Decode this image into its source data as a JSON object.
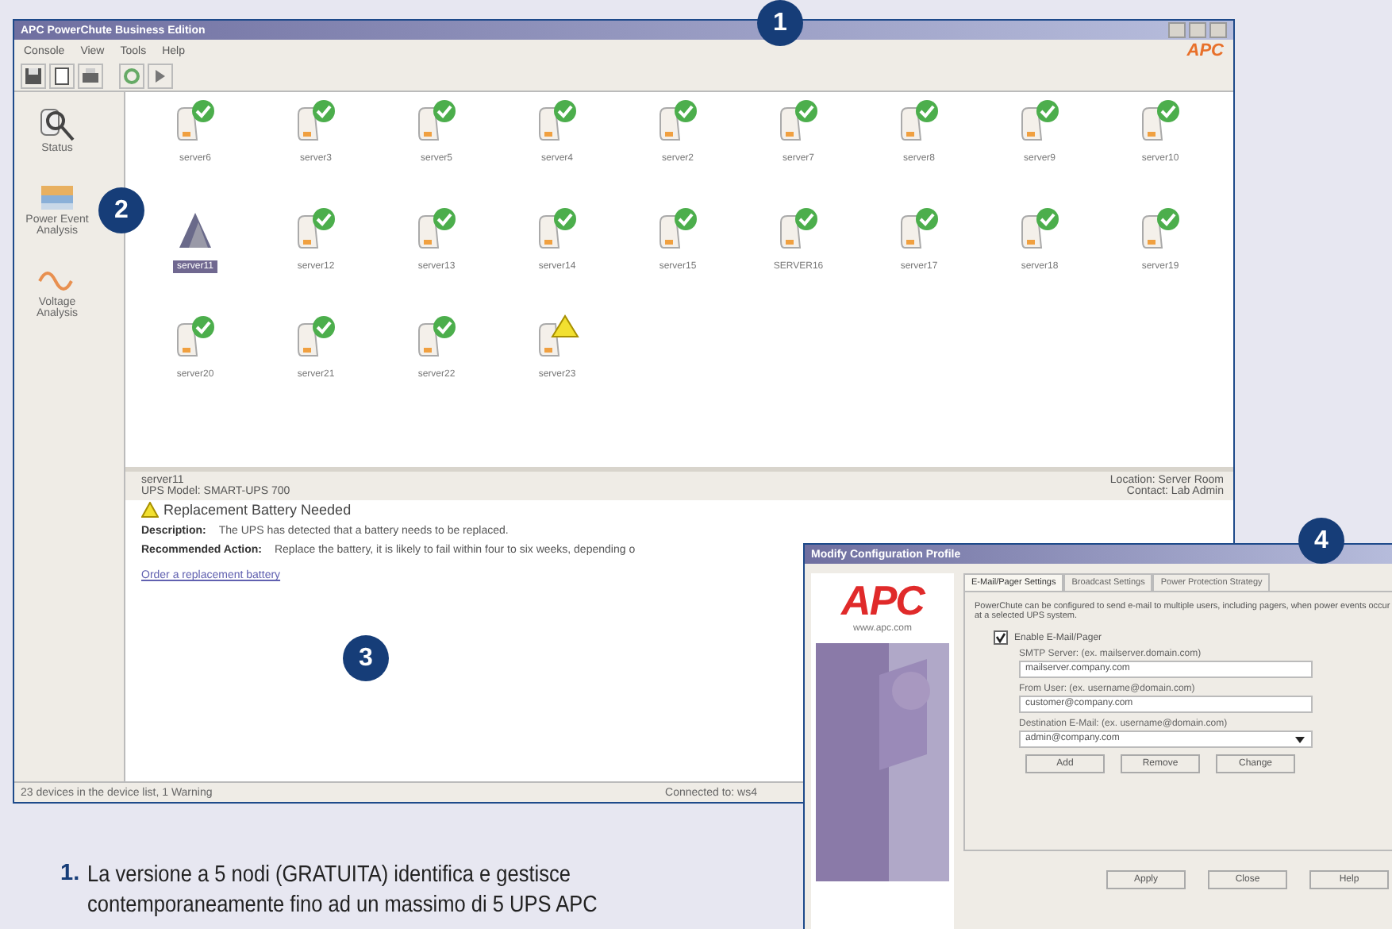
{
  "main_window": {
    "title": "APC PowerChute Business Edition",
    "menu": [
      "Console",
      "View",
      "Tools",
      "Help"
    ],
    "logo": "APC",
    "sidebar": {
      "items": [
        {
          "label": "Status",
          "kind": "status",
          "selected": false
        },
        {
          "label": "Power Event Analysis",
          "kind": "power",
          "selected": false
        },
        {
          "label": "Voltage Analysis",
          "kind": "voltage",
          "selected": false
        }
      ]
    },
    "devices": [
      {
        "name": "server6",
        "kind": "ok",
        "selected": false
      },
      {
        "name": "server3",
        "kind": "ok",
        "selected": false
      },
      {
        "name": "server5",
        "kind": "ok",
        "selected": false
      },
      {
        "name": "server4",
        "kind": "ok",
        "selected": false
      },
      {
        "name": "server2",
        "kind": "ok",
        "selected": false
      },
      {
        "name": "server7",
        "kind": "ok",
        "selected": false
      },
      {
        "name": "server8",
        "kind": "ok",
        "selected": false
      },
      {
        "name": "server9",
        "kind": "ok",
        "selected": false
      },
      {
        "name": "server10",
        "kind": "ok",
        "selected": false
      },
      {
        "name": "server11",
        "kind": "alert",
        "selected": true
      },
      {
        "name": "server12",
        "kind": "ok",
        "selected": false
      },
      {
        "name": "server13",
        "kind": "ok",
        "selected": false
      },
      {
        "name": "server14",
        "kind": "ok",
        "selected": false
      },
      {
        "name": "server15",
        "kind": "ok",
        "selected": false
      },
      {
        "name": "SERVER16",
        "kind": "ok",
        "selected": false
      },
      {
        "name": "server17",
        "kind": "ok",
        "selected": false
      },
      {
        "name": "server18",
        "kind": "ok",
        "selected": false
      },
      {
        "name": "server19",
        "kind": "ok",
        "selected": false
      },
      {
        "name": "server20",
        "kind": "ok",
        "selected": false
      },
      {
        "name": "server21",
        "kind": "ok",
        "selected": false
      },
      {
        "name": "server22",
        "kind": "ok",
        "selected": false
      },
      {
        "name": "server23",
        "kind": "warning",
        "selected": false
      }
    ],
    "detail": {
      "device": "server11",
      "model": "UPS Model: SMART-UPS 700",
      "location": "Location: Server Room",
      "contact": "Contact: Lab Admin",
      "event": "Replacement Battery Needed",
      "description_label": "Description:",
      "description": "The UPS has detected that a battery needs to be replaced.",
      "action_label": "Recommended Action:",
      "action": "Replace the battery, it is likely to fail within four to six weeks, depending o",
      "link": "Order a replacement battery"
    },
    "status_bar": {
      "left": "23 devices in the device list, 1 Warning",
      "right": "Connected to: ws4"
    }
  },
  "dialog": {
    "title": "Modify Configuration Profile",
    "logo": "APC",
    "url": "www.apc.com",
    "tabs": [
      {
        "label": "E-Mail/Pager Settings",
        "selected": true
      },
      {
        "label": "Broadcast Settings",
        "selected": false
      },
      {
        "label": "Power Protection Strategy",
        "selected": false
      }
    ],
    "intro": "PowerChute can be configured to send e-mail to multiple users, including pagers, when power events occur at a selected UPS system.",
    "enable": {
      "label": "Enable E-Mail/Pager",
      "checked": true
    },
    "fields": [
      {
        "label": "SMTP Server: (ex. mailserver.domain.com)",
        "value": "mailserver.company.com",
        "kind": "text"
      },
      {
        "label": "From User: (ex. username@domain.com)",
        "value": "customer@company.com",
        "kind": "text"
      },
      {
        "label": "Destination E-Mail: (ex. username@domain.com)",
        "value": "admin@company.com",
        "kind": "select"
      }
    ],
    "list_buttons": [
      "Add",
      "Remove",
      "Change"
    ],
    "buttons": [
      "Apply",
      "Close",
      "Help"
    ]
  },
  "callouts": [
    "1",
    "2",
    "3",
    "4"
  ],
  "caption": {
    "number": "1.",
    "lines": [
      "La versione a 5 nodi (GRATUITA) identifica e gestisce",
      "contemporaneamente fino ad un massimo di 5 UPS APC"
    ]
  }
}
